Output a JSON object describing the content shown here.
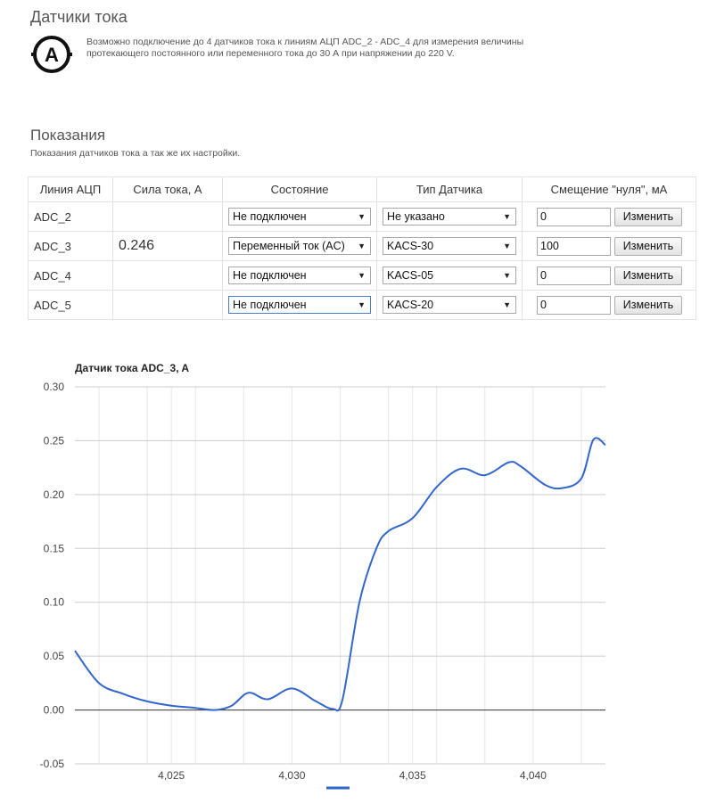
{
  "header": {
    "title": "Датчики тока",
    "icon": "ammeter-icon",
    "icon_letter": "A",
    "description": "Возможно подключение до 4 датчиков тока к линиям АЦП ADC_2 - ADC_4 для измерения величины протекающего постоянного или переменного тока до 30 А при напряжении до 220 V."
  },
  "readings": {
    "title": "Показания",
    "subtitle": "Показания датчиков тока а так же их настройки.",
    "columns": [
      "Линия АЦП",
      "Сила тока, А",
      "Состояние",
      "Тип Датчика",
      "Смещение \"нуля\", мА"
    ],
    "rows": [
      {
        "line": "ADC_2",
        "current": "",
        "state": "Не подключен",
        "type": "Не указано",
        "offset": "0",
        "button": "Изменить"
      },
      {
        "line": "ADC_3",
        "current": "0.246",
        "state": "Переменный ток (AC)",
        "type": "KACS-30",
        "offset": "100",
        "button": "Изменить"
      },
      {
        "line": "ADC_4",
        "current": "",
        "state": "Не подключен",
        "type": "KACS-05",
        "offset": "0",
        "button": "Изменить"
      },
      {
        "line": "ADC_5",
        "current": "",
        "state": "Не подключен",
        "type": "KACS-20",
        "offset": "0",
        "button": "Изменить"
      }
    ]
  },
  "chart_data": {
    "type": "line",
    "title": "Датчик тока ADC_3, A",
    "xlim": [
      4021,
      4043
    ],
    "ylim": [
      -0.05,
      0.3
    ],
    "x_ticks": [
      4025,
      4030,
      4035,
      4040
    ],
    "x_tick_labels": [
      "4,025",
      "4,030",
      "4,035",
      "4,040"
    ],
    "y_ticks": [
      -0.05,
      0.0,
      0.05,
      0.1,
      0.15,
      0.2,
      0.25,
      0.3
    ],
    "y_tick_labels": [
      "-0.05",
      "0.00",
      "0.05",
      "0.10",
      "0.15",
      "0.20",
      "0.25",
      "0.30"
    ],
    "grid": true,
    "legend": "bottom",
    "color": "#3366cc",
    "series": [
      {
        "x": [
          4021,
          4022,
          4023,
          4024,
          4025,
          4026,
          4026.8,
          4027.5,
          4028.2,
          4029,
          4030,
          4031,
          4031.7,
          4032.1,
          4032.8,
          4033.5,
          4034,
          4035,
          4036,
          4037,
          4038,
          4039,
          4039.5,
          4040.5,
          4041.2,
          4042,
          4042.5,
          4043
        ],
        "y": [
          0.055,
          0.025,
          0.015,
          0.008,
          0.004,
          0.002,
          0.0,
          0.004,
          0.016,
          0.01,
          0.02,
          0.008,
          0.001,
          0.01,
          0.1,
          0.15,
          0.166,
          0.178,
          0.207,
          0.224,
          0.218,
          0.23,
          0.226,
          0.209,
          0.206,
          0.215,
          0.251,
          0.246
        ]
      }
    ]
  }
}
